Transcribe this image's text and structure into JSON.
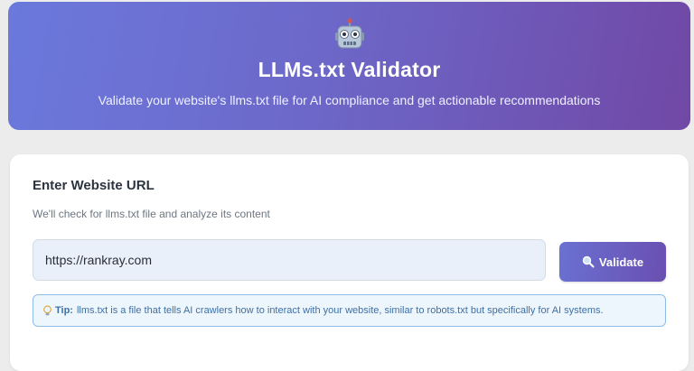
{
  "header": {
    "icon": "robot-icon",
    "title": "LLMs.txt Validator",
    "subtitle": "Validate your website's llms.txt file for AI compliance and get actionable recommendations"
  },
  "form": {
    "heading": "Enter Website URL",
    "description": "We'll check for llms.txt file and analyze its content",
    "url_value": "https://rankray.com",
    "validate_label": "Validate",
    "validate_icon": "magnifier-icon"
  },
  "tip": {
    "icon": "lightbulb-icon",
    "label": "Tip:",
    "text": "llms.txt is a file that tells AI crawlers how to interact with your website, similar to robots.txt but specifically for AI systems."
  },
  "colors": {
    "hero_gradient_start": "#6b79dc",
    "hero_gradient_end": "#7148a6",
    "button_start": "#6a71d2",
    "button_end": "#6a4fb0",
    "tip_border": "#8fbde8",
    "tip_text": "#3d6fa5"
  }
}
